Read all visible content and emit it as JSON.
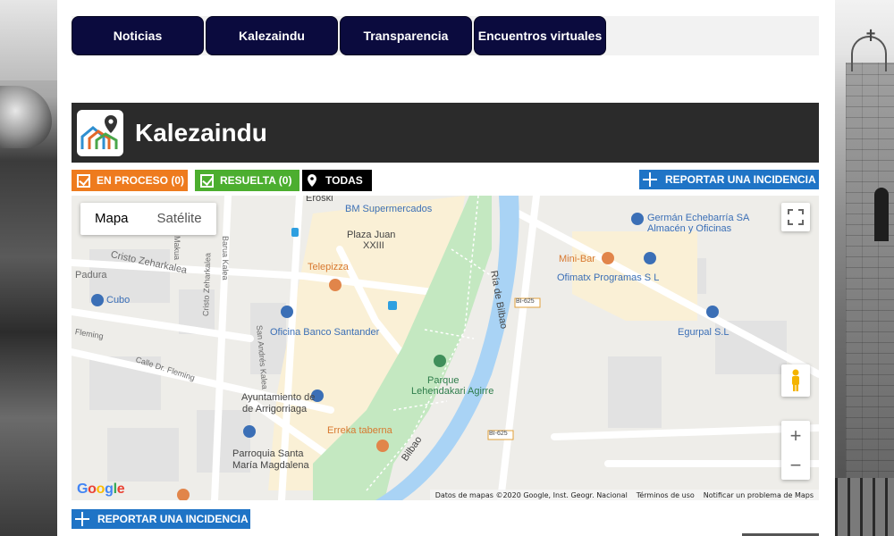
{
  "nav": {
    "tabs": [
      "Noticias",
      "Kalezaindu",
      "Transparencia",
      "Encuentros virtuales"
    ]
  },
  "header": {
    "title": "Kalezaindu",
    "logo_icon": "house-map-pin-icon"
  },
  "filters": {
    "en_proceso": "EN PROCESO (0)",
    "resuelta": "RESUELTA (0)",
    "todas": "TODAS"
  },
  "actions": {
    "report_top": "REPORTAR UNA INCIDENCIA",
    "report_bottom": "REPORTAR UNA INCIDENCIA"
  },
  "map": {
    "type_map": "Mapa",
    "type_satellite": "Satélite",
    "google": "Google",
    "attribution": "Datos de mapas ©2020 Google, Inst. Geogr. Nacional",
    "terms": "Términos de uso",
    "report_problem": "Notificar un problema de Maps",
    "labels": {
      "eroski": "Eroski",
      "bm": "BM Supermercados",
      "plaza_juan": "Plaza Juan",
      "plaza_juan_2": "XXIII",
      "telepizza": "Telepizza",
      "banco": "Oficina Banco Santander",
      "ayuntamiento": "Ayuntamiento de",
      "ayuntamiento_2": "de Arrigorriaga",
      "parroquia": "Parroquia Santa",
      "parroquia_2": "María Magdalena",
      "erreka": "Erreka taberna",
      "parque": "Parque",
      "parque_2": "Lehendakari Agirre",
      "german": "Germán Echebarría SA",
      "german_2": "Almacén y Oficinas",
      "minibar": "Mini-Bar",
      "ofimatx": "Ofimatx Programas S L",
      "egurpal": "Egurpal S.L",
      "cubo": "Cubo",
      "padura": "Padura",
      "cristo": "Cristo Zeharkalea",
      "cristo_v": "Cristo Zeharkalea",
      "barua": "Barua Kalea",
      "makua": "Makua",
      "fleming": "Calle Dr. Fleming",
      "fleming_short": "Fleming",
      "san_andres": "San Andrés Kalea",
      "ria": "Ría de Bilbao",
      "bilbao": "Bilbao",
      "bi625": "BI-625",
      "bi625_b": "BI-625"
    }
  }
}
